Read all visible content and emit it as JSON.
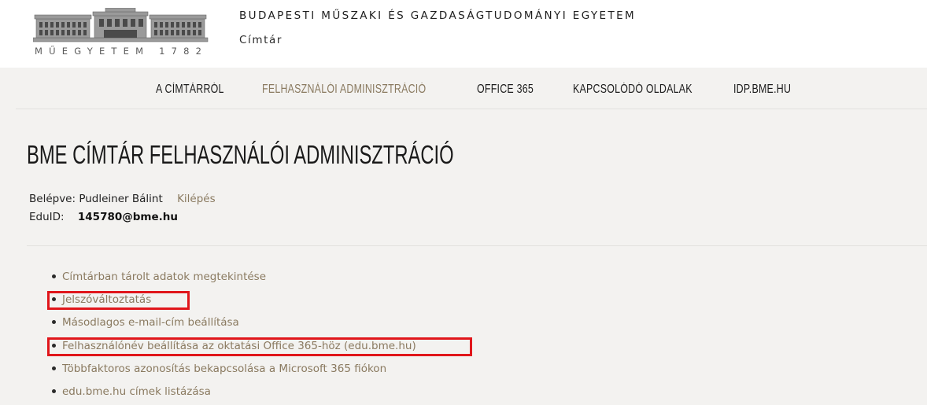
{
  "header": {
    "logo_text": "MŰEGYETEM 1782",
    "university_name": "BUDAPESTI MŰSZAKI ÉS GAZDASÁGTUDOMÁNYI EGYETEM",
    "subtitle": "Címtár"
  },
  "nav": {
    "items": [
      {
        "label": "A CÍMTÁRRÓL",
        "active": false
      },
      {
        "label": "FELHASZNÁLÓI ADMINISZTRÁCIÓ",
        "active": true
      },
      {
        "label": "OFFICE 365",
        "active": false
      },
      {
        "label": "KAPCSOLÓDÓ OLDALAK",
        "active": false
      },
      {
        "label": "IDP.BME.HU",
        "active": false
      }
    ]
  },
  "main": {
    "title": "BME CÍMTÁR FELHASZNÁLÓI ADMINISZTRÁCIÓ",
    "login": {
      "label": "Belépve:",
      "user": "Pudleiner Bálint",
      "logout": "Kilépés"
    },
    "eduid": {
      "label": "EduID:",
      "value": "145780@bme.hu"
    },
    "actions": [
      {
        "label": "Címtárban tárolt adatok megtekintése",
        "highlighted": false
      },
      {
        "label": "Jelszóváltoztatás",
        "highlighted": true
      },
      {
        "label": "Másodlagos e-mail-cím beállítása",
        "highlighted": false
      },
      {
        "label": "Felhasználónév beállítása az oktatási Office 365-höz (edu.bme.hu)",
        "highlighted": true
      },
      {
        "label": "Többfaktoros azonosítás bekapcsolása a Microsoft 365 fiókon",
        "highlighted": false
      },
      {
        "label": "edu.bme.hu címek listázása",
        "highlighted": false
      }
    ]
  },
  "colors": {
    "accent": "#8a7a60",
    "highlight": "#e0161b",
    "page_background": "#f3f2f0"
  }
}
